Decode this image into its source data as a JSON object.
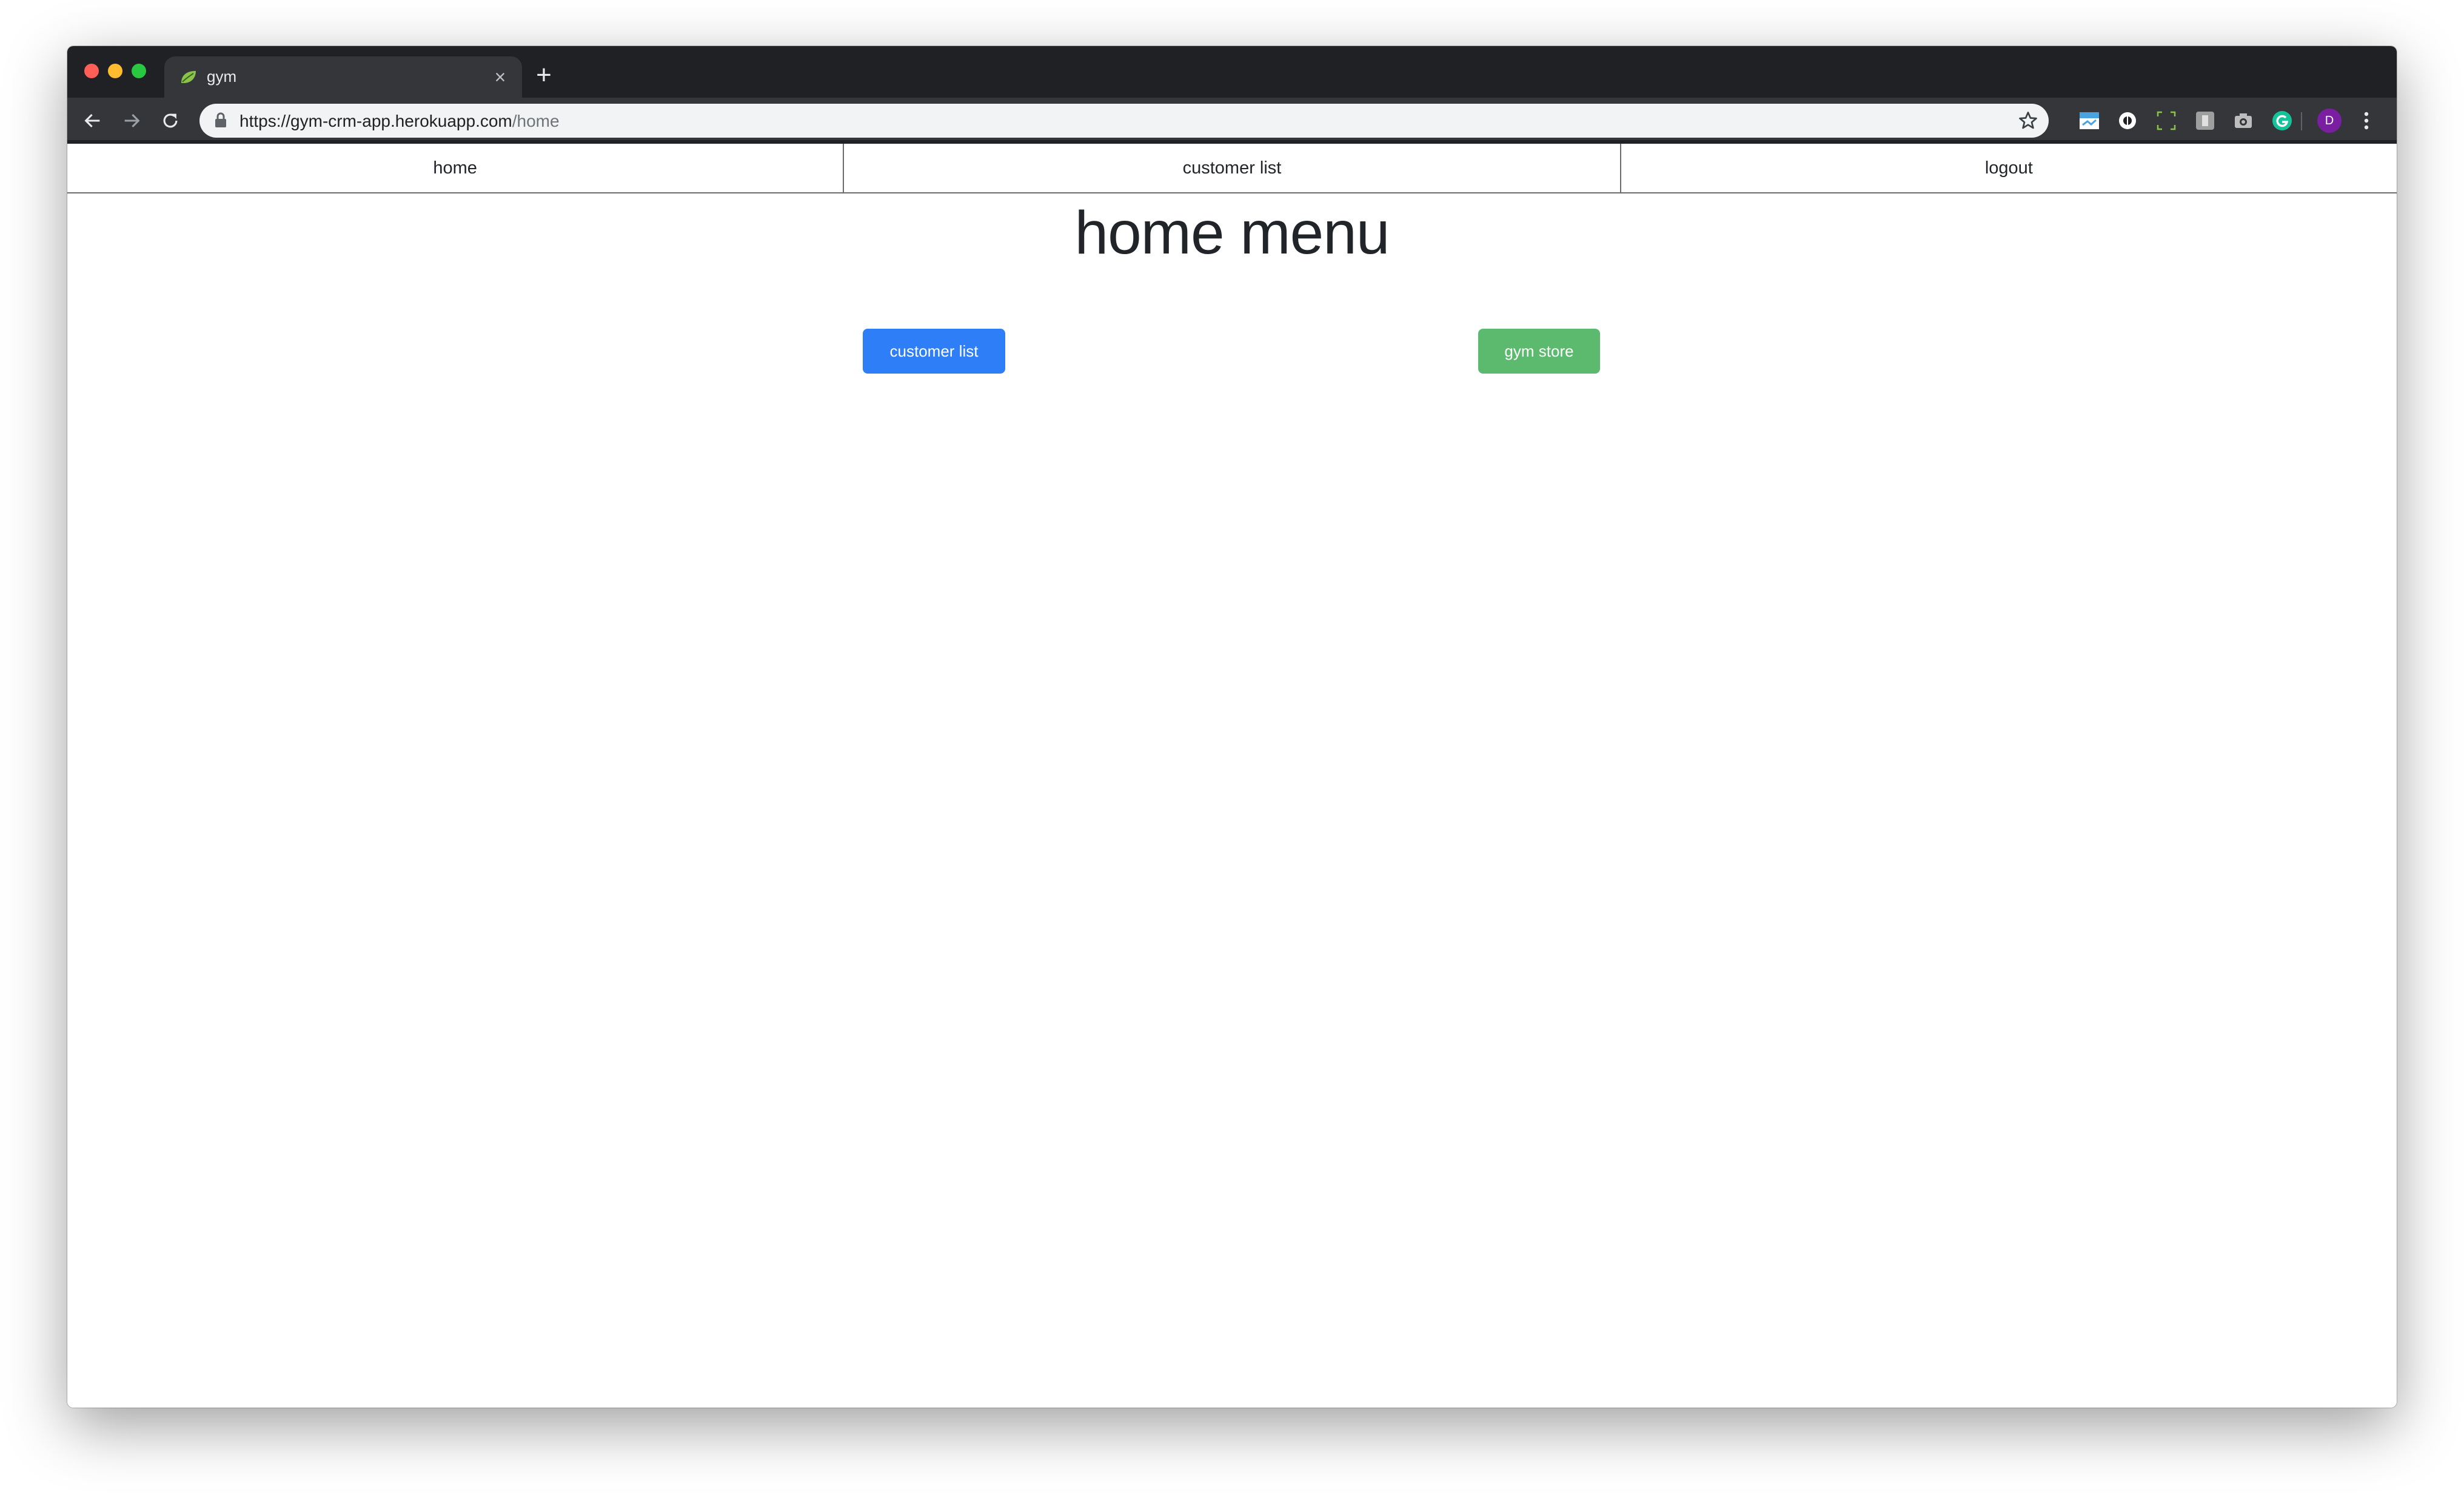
{
  "browser": {
    "tab": {
      "title": "gym",
      "close_label": "×"
    },
    "new_tab_label": "+",
    "address": {
      "scheme": "https://",
      "host": "gym-crm-app.herokuapp.com",
      "path": "/home"
    },
    "profile_initial": "D"
  },
  "nav": {
    "items": [
      {
        "label": "home"
      },
      {
        "label": "customer list"
      },
      {
        "label": "logout"
      }
    ]
  },
  "main": {
    "title": "home menu",
    "buttons": [
      {
        "label": "customer list",
        "color": "#2e7ef7"
      },
      {
        "label": "gym store",
        "color": "#5cba6f"
      }
    ]
  },
  "icons": {
    "tab_favicon": "spring-leaf-icon",
    "back": "arrow-left-icon",
    "forward": "arrow-right-icon",
    "reload": "reload-icon",
    "lock": "lock-icon",
    "bookmark": "star-icon",
    "extensions": [
      "calendar-icon",
      "circle-icon",
      "screenshot-frame-icon",
      "puzzle-icon",
      "camera-icon",
      "grammarly-icon"
    ],
    "menu": "more-vert-icon"
  }
}
